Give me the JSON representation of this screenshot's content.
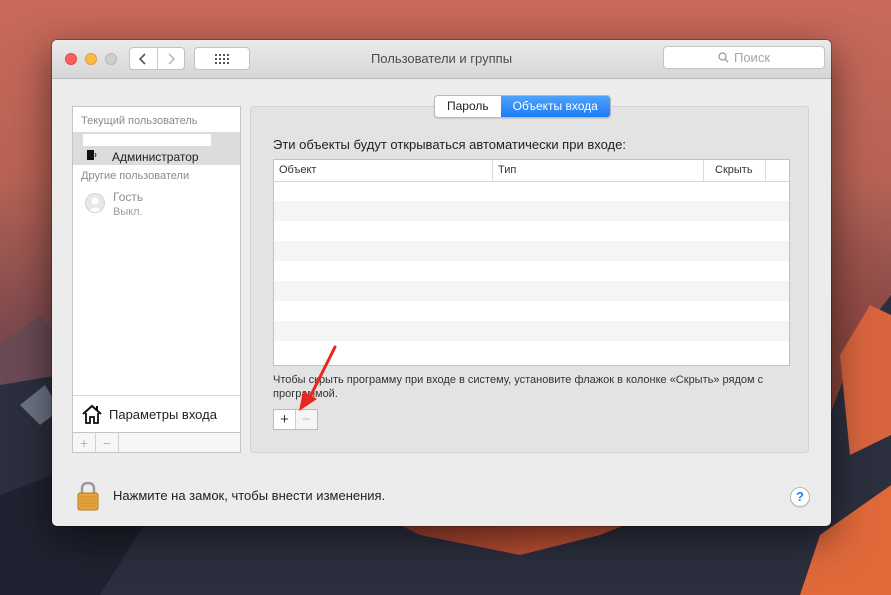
{
  "window": {
    "title": "Пользователи и группы",
    "search_placeholder": "Поиск"
  },
  "sidebar": {
    "current_user_heading": "Текущий пользователь",
    "current_user_role": "Администратор",
    "other_users_heading": "Другие пользователи",
    "guest_name": "Гость",
    "guest_status": "Выкл.",
    "login_options_label": "Параметры входа",
    "add_label": "+",
    "remove_label": "−"
  },
  "tabs": [
    {
      "label": "Пароль",
      "active": false
    },
    {
      "label": "Объекты входа",
      "active": true
    }
  ],
  "login_items": {
    "description": "Эти объекты будут открываться автоматически при входе:",
    "columns": [
      "Объект",
      "Тип",
      "Скрыть"
    ],
    "rows": [],
    "hint": "Чтобы скрыть программу при входе в систему, установите флажок в колонке «Скрыть» рядом с программой.",
    "add_label": "+",
    "remove_label": "−"
  },
  "footer": {
    "lock_text": "Нажмите на замок, чтобы внести изменения.",
    "help_label": "?"
  },
  "colors": {
    "accent": "#1b7bf5",
    "annotation_arrow": "#e8281f"
  }
}
